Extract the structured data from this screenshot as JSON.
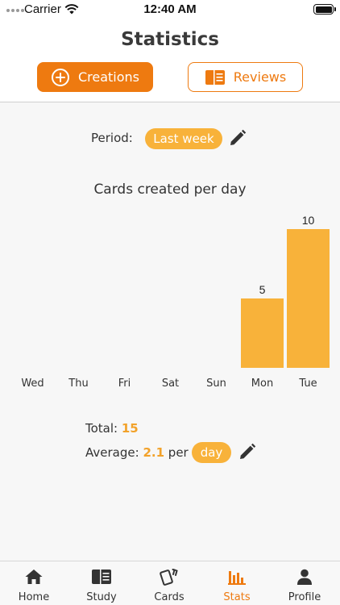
{
  "status_bar": {
    "carrier": "Carrier",
    "time": "12:40 AM"
  },
  "header": {
    "title": "Statistics",
    "segments": [
      {
        "label": "Creations",
        "icon": "plus-circle-icon",
        "selected": true
      },
      {
        "label": "Reviews",
        "icon": "book-icon",
        "selected": false
      }
    ]
  },
  "filters": {
    "period_label": "Period:",
    "period_value": "Last week"
  },
  "chart_data": {
    "type": "bar",
    "title": "Cards created per day",
    "categories": [
      "Wed",
      "Thu",
      "Fri",
      "Sat",
      "Sun",
      "Mon",
      "Tue"
    ],
    "values": [
      0,
      0,
      0,
      0,
      0,
      5,
      10
    ],
    "ylim": [
      0,
      10
    ],
    "bar_color": "#f8b23a",
    "grid": false
  },
  "summary": {
    "total_label": "Total:",
    "total_value": "15",
    "average_label": "Average:",
    "average_value": "2.1",
    "average_per": "per",
    "average_unit": "day"
  },
  "tabbar": {
    "items": [
      {
        "label": "Home",
        "icon": "home-icon",
        "active": false
      },
      {
        "label": "Study",
        "icon": "book-icon",
        "active": false
      },
      {
        "label": "Cards",
        "icon": "cards-icon",
        "active": false
      },
      {
        "label": "Stats",
        "icon": "bar-chart-icon",
        "active": true
      },
      {
        "label": "Profile",
        "icon": "person-icon",
        "active": false
      }
    ]
  },
  "colors": {
    "accent": "#ee7a10",
    "pill": "#f8b23a",
    "value_text": "#f2a22a"
  }
}
